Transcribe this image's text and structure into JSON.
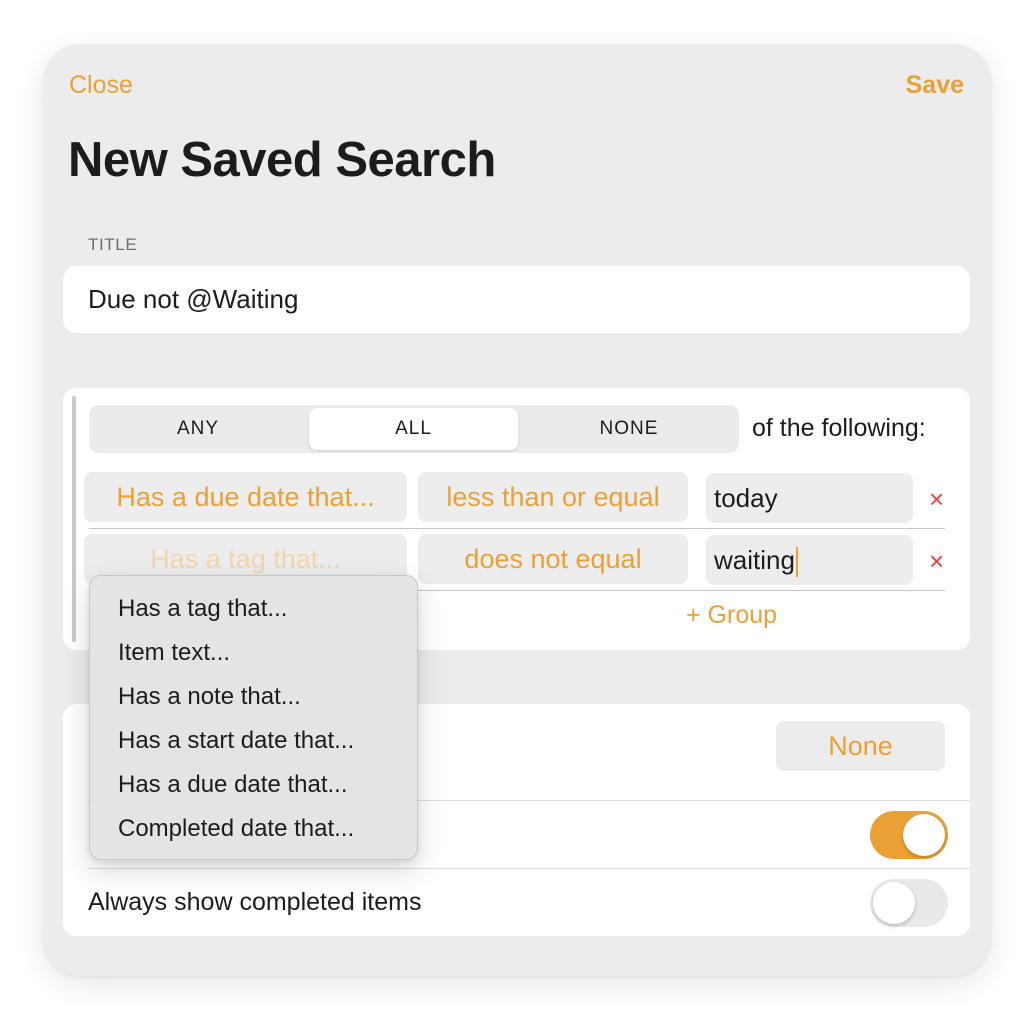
{
  "nav": {
    "close_label": "Close",
    "save_label": "Save"
  },
  "page_title": "New Saved Search",
  "title_section": {
    "label": "TITLE",
    "value": "Due not @Waiting"
  },
  "match_mode": {
    "options": [
      "ANY",
      "ALL",
      "NONE"
    ],
    "selected": "ALL",
    "suffix": "of the following:"
  },
  "rules": [
    {
      "field": "Has a due date that...",
      "operator": "less than or equal",
      "value": "today",
      "remove_icon": "×"
    },
    {
      "field": "Has a tag that...",
      "operator": "does not equal",
      "value": "waiting",
      "remove_icon": "×"
    }
  ],
  "add_group_label": "+ Group",
  "options": {
    "sort_value": "None",
    "toggle_on": true,
    "always_show_completed_label": "Always show completed items",
    "always_show_completed": false
  },
  "field_menu": {
    "items": [
      "Has a tag that...",
      "Item text...",
      "Has a note that...",
      "Has a start date that...",
      "Has a due date that...",
      "Completed date that..."
    ]
  },
  "colors": {
    "accent": "#eba035",
    "danger": "#e6473e",
    "background": "#ececed"
  }
}
